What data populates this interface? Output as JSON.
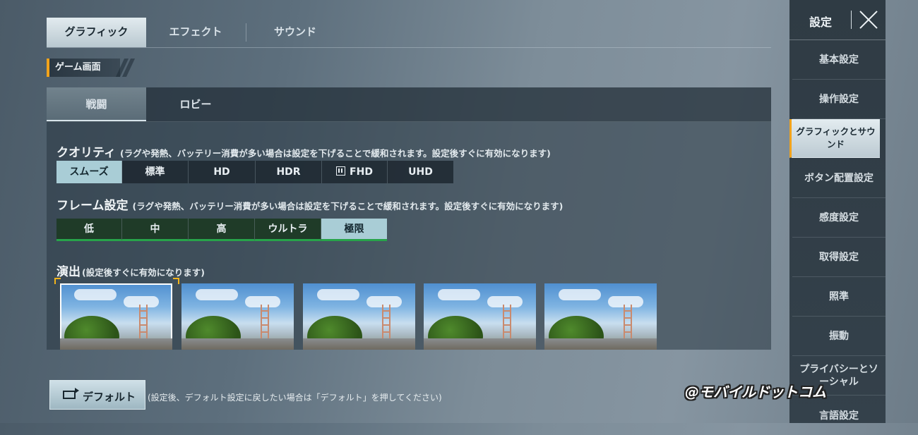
{
  "top_tabs": [
    "グラフィック",
    "エフェクト",
    "サウンド"
  ],
  "section_header": "ゲーム画面",
  "sub_tabs": [
    "戦闘",
    "ロビー"
  ],
  "quality": {
    "title": "クオリティ",
    "note": "(ラグや発熱、バッテリー消費が多い場合は設定を下げることで緩和されます。設定後すぐに有効になります)",
    "options": [
      "スムーズ",
      "標準",
      "HD",
      "HDR",
      "FHD",
      "UHD"
    ],
    "selected": "スムーズ"
  },
  "frame": {
    "title": "フレーム設定",
    "note": "(ラグや発熱、バッテリー消費が多い場合は設定を下げることで緩和されます。設定後すぐに有効になります)",
    "options": [
      "低",
      "中",
      "高",
      "ウルトラ",
      "極限"
    ],
    "selected": "極限"
  },
  "effects": {
    "title": "演出",
    "note": "(設定後すぐに有効になります)",
    "thumbnail_count": 5,
    "selected_index": 0
  },
  "sidebar": {
    "title": "設定",
    "items": [
      "基本設定",
      "操作設定",
      "グラフィックとサウンド",
      "ボタン配置設定",
      "感度設定",
      "取得設定",
      "照準",
      "振動",
      "プライバシーとソーシャル",
      "言語設定"
    ],
    "active": "グラフィックとサウンド"
  },
  "bottom": {
    "default_label": "デフォルト",
    "default_note": "(設定後、デフォルト設定に戻したい場合は「デフォルト」を押してください)"
  },
  "watermark": "@モバイルドットコム",
  "colors": {
    "accent": "#f2a31b",
    "selected_option": "#a9cdd6",
    "frame_bar": "#27a34a"
  }
}
